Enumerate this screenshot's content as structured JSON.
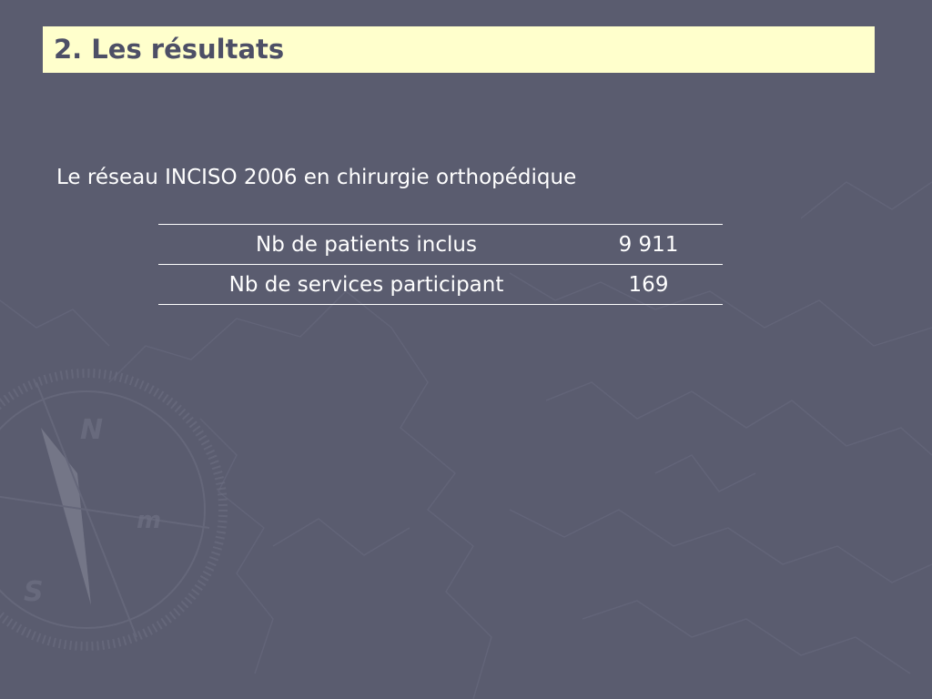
{
  "slide": {
    "title": "2. Les résultats",
    "subtitle": "Le réseau INCISO 2006 en chirurgie orthopédique"
  },
  "table": {
    "rows": [
      {
        "label": "Nb de patients inclus",
        "value": "9 911"
      },
      {
        "label": "Nb de services participant",
        "value": "169"
      }
    ]
  },
  "colors": {
    "background": "#5a5c6f",
    "title_bar": "#ffffcc",
    "title_text": "#4d4f66",
    "text": "#ffffff"
  },
  "decoration": {
    "compass_letters": [
      "N",
      "S",
      "m"
    ]
  }
}
